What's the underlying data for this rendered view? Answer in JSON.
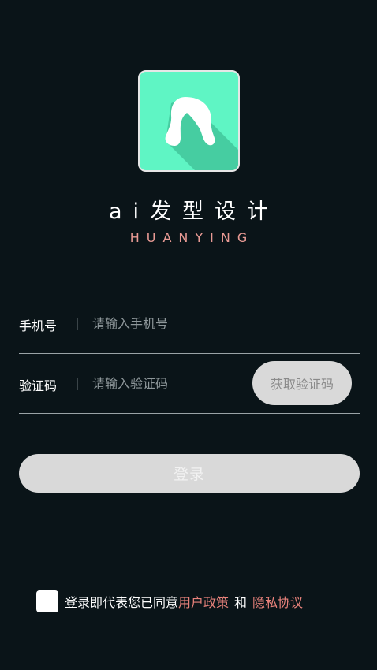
{
  "app": {
    "title": "ai发型设计",
    "subtitle": "HUANYING"
  },
  "form": {
    "phone_label": "手机号",
    "phone_separator": "|",
    "phone_placeholder": "请输入手机号",
    "phone_value": "",
    "code_label": "验证码",
    "code_separator": "|",
    "code_placeholder": "请输入验证码",
    "code_value": "",
    "get_code_label": "获取验证码",
    "login_label": "登录"
  },
  "agreement": {
    "prefix": "登录即代表您已同意",
    "user_policy": "用户政策",
    "and": "和",
    "privacy_policy": "隐私协议",
    "checked": false
  },
  "icons": {
    "logo": "hair-silhouette-icon",
    "checkbox": "checkbox-icon"
  },
  "colors": {
    "background": "#0a1418",
    "logo_bg": "#5ff5c4",
    "accent": "#e8827b",
    "button_bg": "#d9d9d9"
  }
}
